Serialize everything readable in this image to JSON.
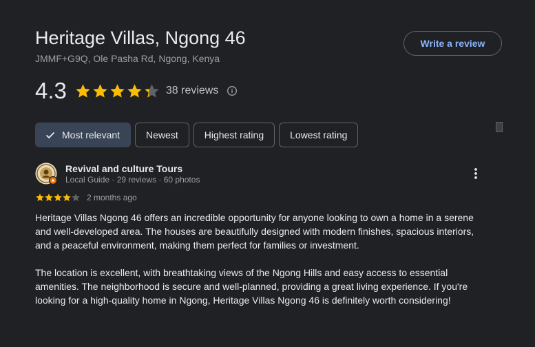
{
  "place": {
    "title": "Heritage Villas, Ngong 46",
    "address": "JMMF+G9Q, Ole Pasha Rd, Ngong, Kenya",
    "write_review_label": "Write a review",
    "rating": "4.3",
    "rating_value": 4.3,
    "reviews_count_label": "38 reviews"
  },
  "sort_chips": [
    {
      "label": "Most relevant",
      "selected": true
    },
    {
      "label": "Newest",
      "selected": false
    },
    {
      "label": "Highest rating",
      "selected": false
    },
    {
      "label": "Lowest rating",
      "selected": false
    }
  ],
  "review": {
    "author": "Revival and culture Tours",
    "meta": "Local Guide · 29 reviews · 60 photos",
    "stars": 4,
    "date": "2 months ago",
    "paragraphs": [
      "Heritage Villas Ngong 46 offers an incredible opportunity for anyone looking to own a home in a serene and well-developed area. The houses are beautifully designed with modern finishes, spacious interiors, and a peaceful environment, making them perfect for families or investment.",
      "The location is excellent, with breathtaking views of the Ngong Hills and easy access to essential amenities. The neighborhood is secure and well-planned, providing a great living experience. If you're looking for a high-quality home in Ngong, Heritage Villas Ngong 46 is definitely worth considering!"
    ]
  },
  "icons": {
    "info": "info-icon",
    "check": "check-icon",
    "more": "more-vert-icon",
    "star": "star-icon"
  },
  "colors": {
    "background": "#202124",
    "star_filled": "#fbbc04",
    "star_empty": "#5f6368",
    "accent": "#8ab4f8",
    "selected_chip": "#394457"
  }
}
